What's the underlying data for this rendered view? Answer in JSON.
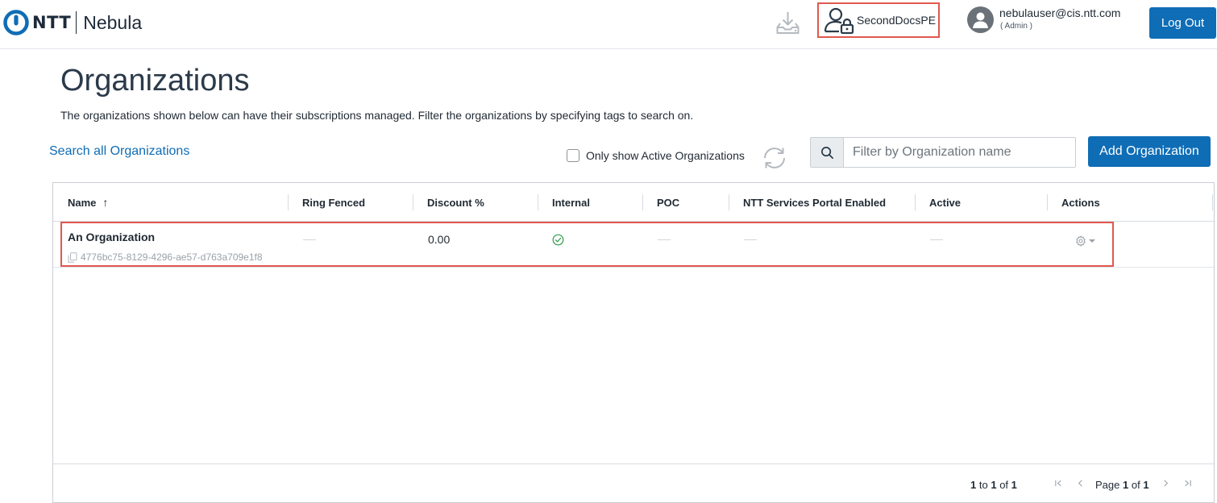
{
  "header": {
    "brand": "NTT",
    "app_name": "Nebula",
    "tenant_name": "SecondDocsPE",
    "user_email": "nebulauser@cis.ntt.com",
    "user_role": "( Admin )",
    "logout_label": "Log Out"
  },
  "page": {
    "title": "Organizations",
    "description": "The organizations shown below can have their subscriptions managed. Filter the organizations by specifying tags to search on."
  },
  "toolbar": {
    "search_all_label": "Search all Organizations",
    "active_only_label": "Only show Active Organizations",
    "active_only_checked": false,
    "filter_placeholder": "Filter by Organization name",
    "filter_value": "",
    "add_label": "Add Organization"
  },
  "table": {
    "columns": {
      "name": "Name",
      "ring_fenced": "Ring Fenced",
      "discount": "Discount %",
      "internal": "Internal",
      "poc": "POC",
      "portal": "NTT Services Portal Enabled",
      "active": "Active",
      "actions": "Actions"
    },
    "rows": [
      {
        "name": "An Organization",
        "id": "4776bc75-8129-4296-ae57-d763a709e1f8",
        "ring_fenced": false,
        "discount": "0.00",
        "internal": true,
        "poc": false,
        "portal": false,
        "active": false
      }
    ]
  },
  "pagination": {
    "from": "1",
    "to_word": "to",
    "to": "1",
    "of_word": "of",
    "total": "1",
    "page_word": "Page",
    "page": "1",
    "page_of_word": "of",
    "pages": "1"
  },
  "colors": {
    "primary": "#0f6db6",
    "highlight": "#e0584f",
    "success": "#2e9b48"
  },
  "icons": {
    "logo": "ntt-ring-icon",
    "download": "download-icon",
    "tenant": "user-lock-icon",
    "avatar": "user-avatar-icon",
    "refresh": "refresh-icon",
    "search": "search-icon",
    "copy": "copy-icon",
    "check": "check-circle-icon",
    "gear": "gear-icon"
  }
}
